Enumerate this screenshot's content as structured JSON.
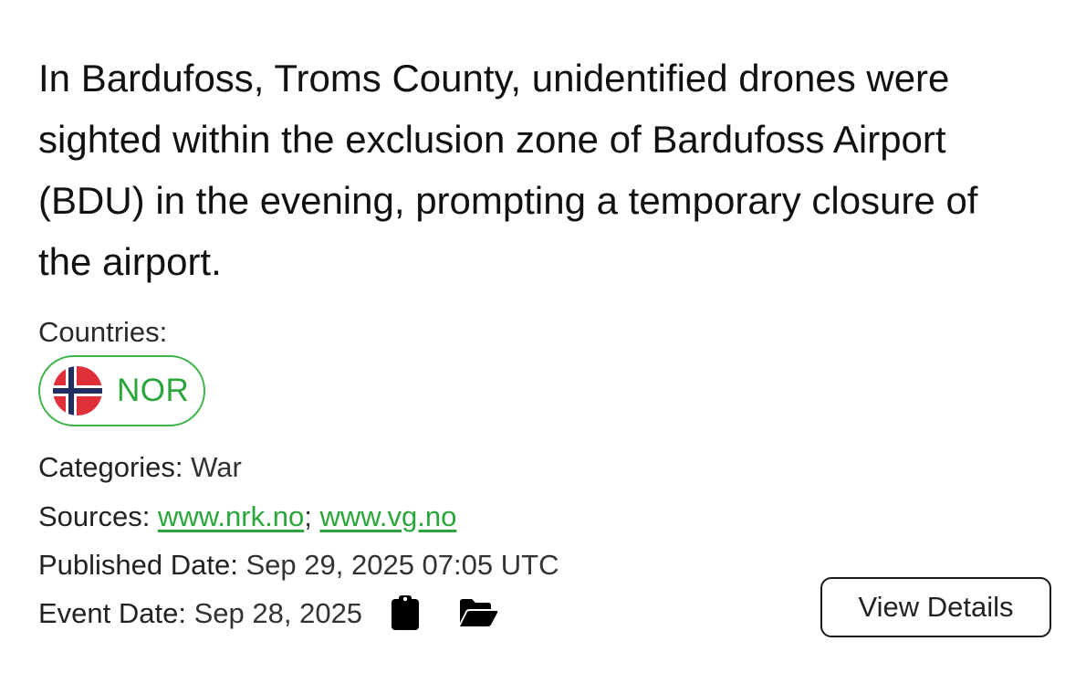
{
  "event": {
    "headline": "In Bardufoss, Troms County, unidentified drones were sighted within the exclusion zone of Bardufoss Airport (BDU) in the evening, prompting a temporary closure of the airport.",
    "countries_label": "Countries:",
    "countries": [
      {
        "code": "NOR",
        "flag_icon": "norway-flag-icon"
      }
    ],
    "categories_label": "Categories:",
    "categories_value": "War",
    "sources_label": "Sources:",
    "sources": [
      {
        "text": "www.nrk.no"
      },
      {
        "text": "www.vg.no"
      }
    ],
    "sources_separator": ";",
    "published_label": "Published Date:",
    "published_value": "Sep 29, 2025 07:05 UTC",
    "event_date_label": "Event Date:",
    "event_date_value": "Sep 28, 2025",
    "icons": [
      "clipboard-icon",
      "open-folder-icon"
    ],
    "view_details_label": "View Details"
  },
  "colors": {
    "accent_green": "#2aa63a",
    "pill_border": "#3cb44b",
    "text": "#1a1a1a"
  }
}
